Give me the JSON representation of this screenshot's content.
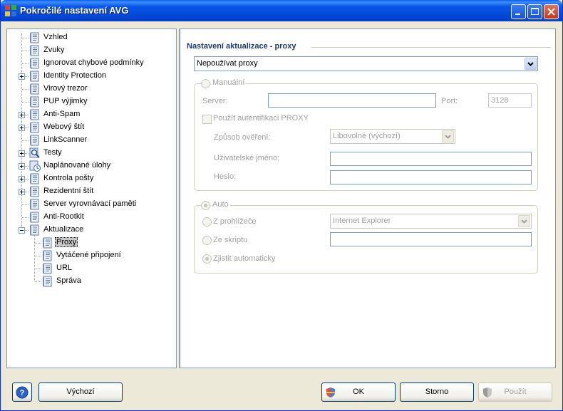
{
  "window": {
    "title": "Pokročilé nastavení AVG"
  },
  "tree": {
    "items": [
      {
        "label": "Vzhled",
        "expandable": false
      },
      {
        "label": "Zvuky",
        "expandable": false
      },
      {
        "label": "Ignorovat chybové podmínky",
        "expandable": false
      },
      {
        "label": "Identity Protection",
        "expandable": true
      },
      {
        "label": "Virový trezor",
        "expandable": false
      },
      {
        "label": "PUP výjimky",
        "expandable": false
      },
      {
        "label": "Anti-Spam",
        "expandable": true
      },
      {
        "label": "Webový štít",
        "expandable": true
      },
      {
        "label": "LinkScanner",
        "expandable": false
      },
      {
        "label": "Testy",
        "expandable": true
      },
      {
        "label": "Naplánované úlohy",
        "expandable": true
      },
      {
        "label": "Kontrola pošty",
        "expandable": true
      },
      {
        "label": "Rezidentní štít",
        "expandable": true
      },
      {
        "label": "Server vyrovnávací paměti",
        "expandable": false
      },
      {
        "label": "Anti-Rootkit",
        "expandable": false
      },
      {
        "label": "Aktualizace",
        "expandable": true,
        "expanded": true
      }
    ],
    "children": [
      {
        "label": "Proxy",
        "selected": true
      },
      {
        "label": "Vytáčené připojení"
      },
      {
        "label": "URL"
      },
      {
        "label": "Správa"
      }
    ]
  },
  "panel": {
    "title": "Nastavení aktualizace - proxy",
    "proxy_mode": "Nepoužívat proxy",
    "manual": {
      "legend": "Manuální",
      "server_label": "Server:",
      "server_value": "",
      "port_label": "Port:",
      "port_value": "3128",
      "auth_label": "Použít autentifikaci PROXY",
      "auth_method_label": "Způsob ověření:",
      "auth_method_value": "Libovolné (výchozí)",
      "username_label": "Uživatelské jméno:",
      "password_label": "Heslo:"
    },
    "auto": {
      "legend": "Auto",
      "browser_label": "Z prohlížeče",
      "browser_value": "Internet Explorer",
      "script_label": "Ze skriptu",
      "detect_label": "Zjistit automaticky"
    }
  },
  "buttons": {
    "help": "?",
    "default": "Výchozí",
    "ok": "OK",
    "cancel": "Storno",
    "apply": "Použít"
  },
  "colors": {
    "titlebar": "#0a56e8",
    "section_title": "#1c3a78",
    "disabled_text": "#a0a0a0"
  }
}
